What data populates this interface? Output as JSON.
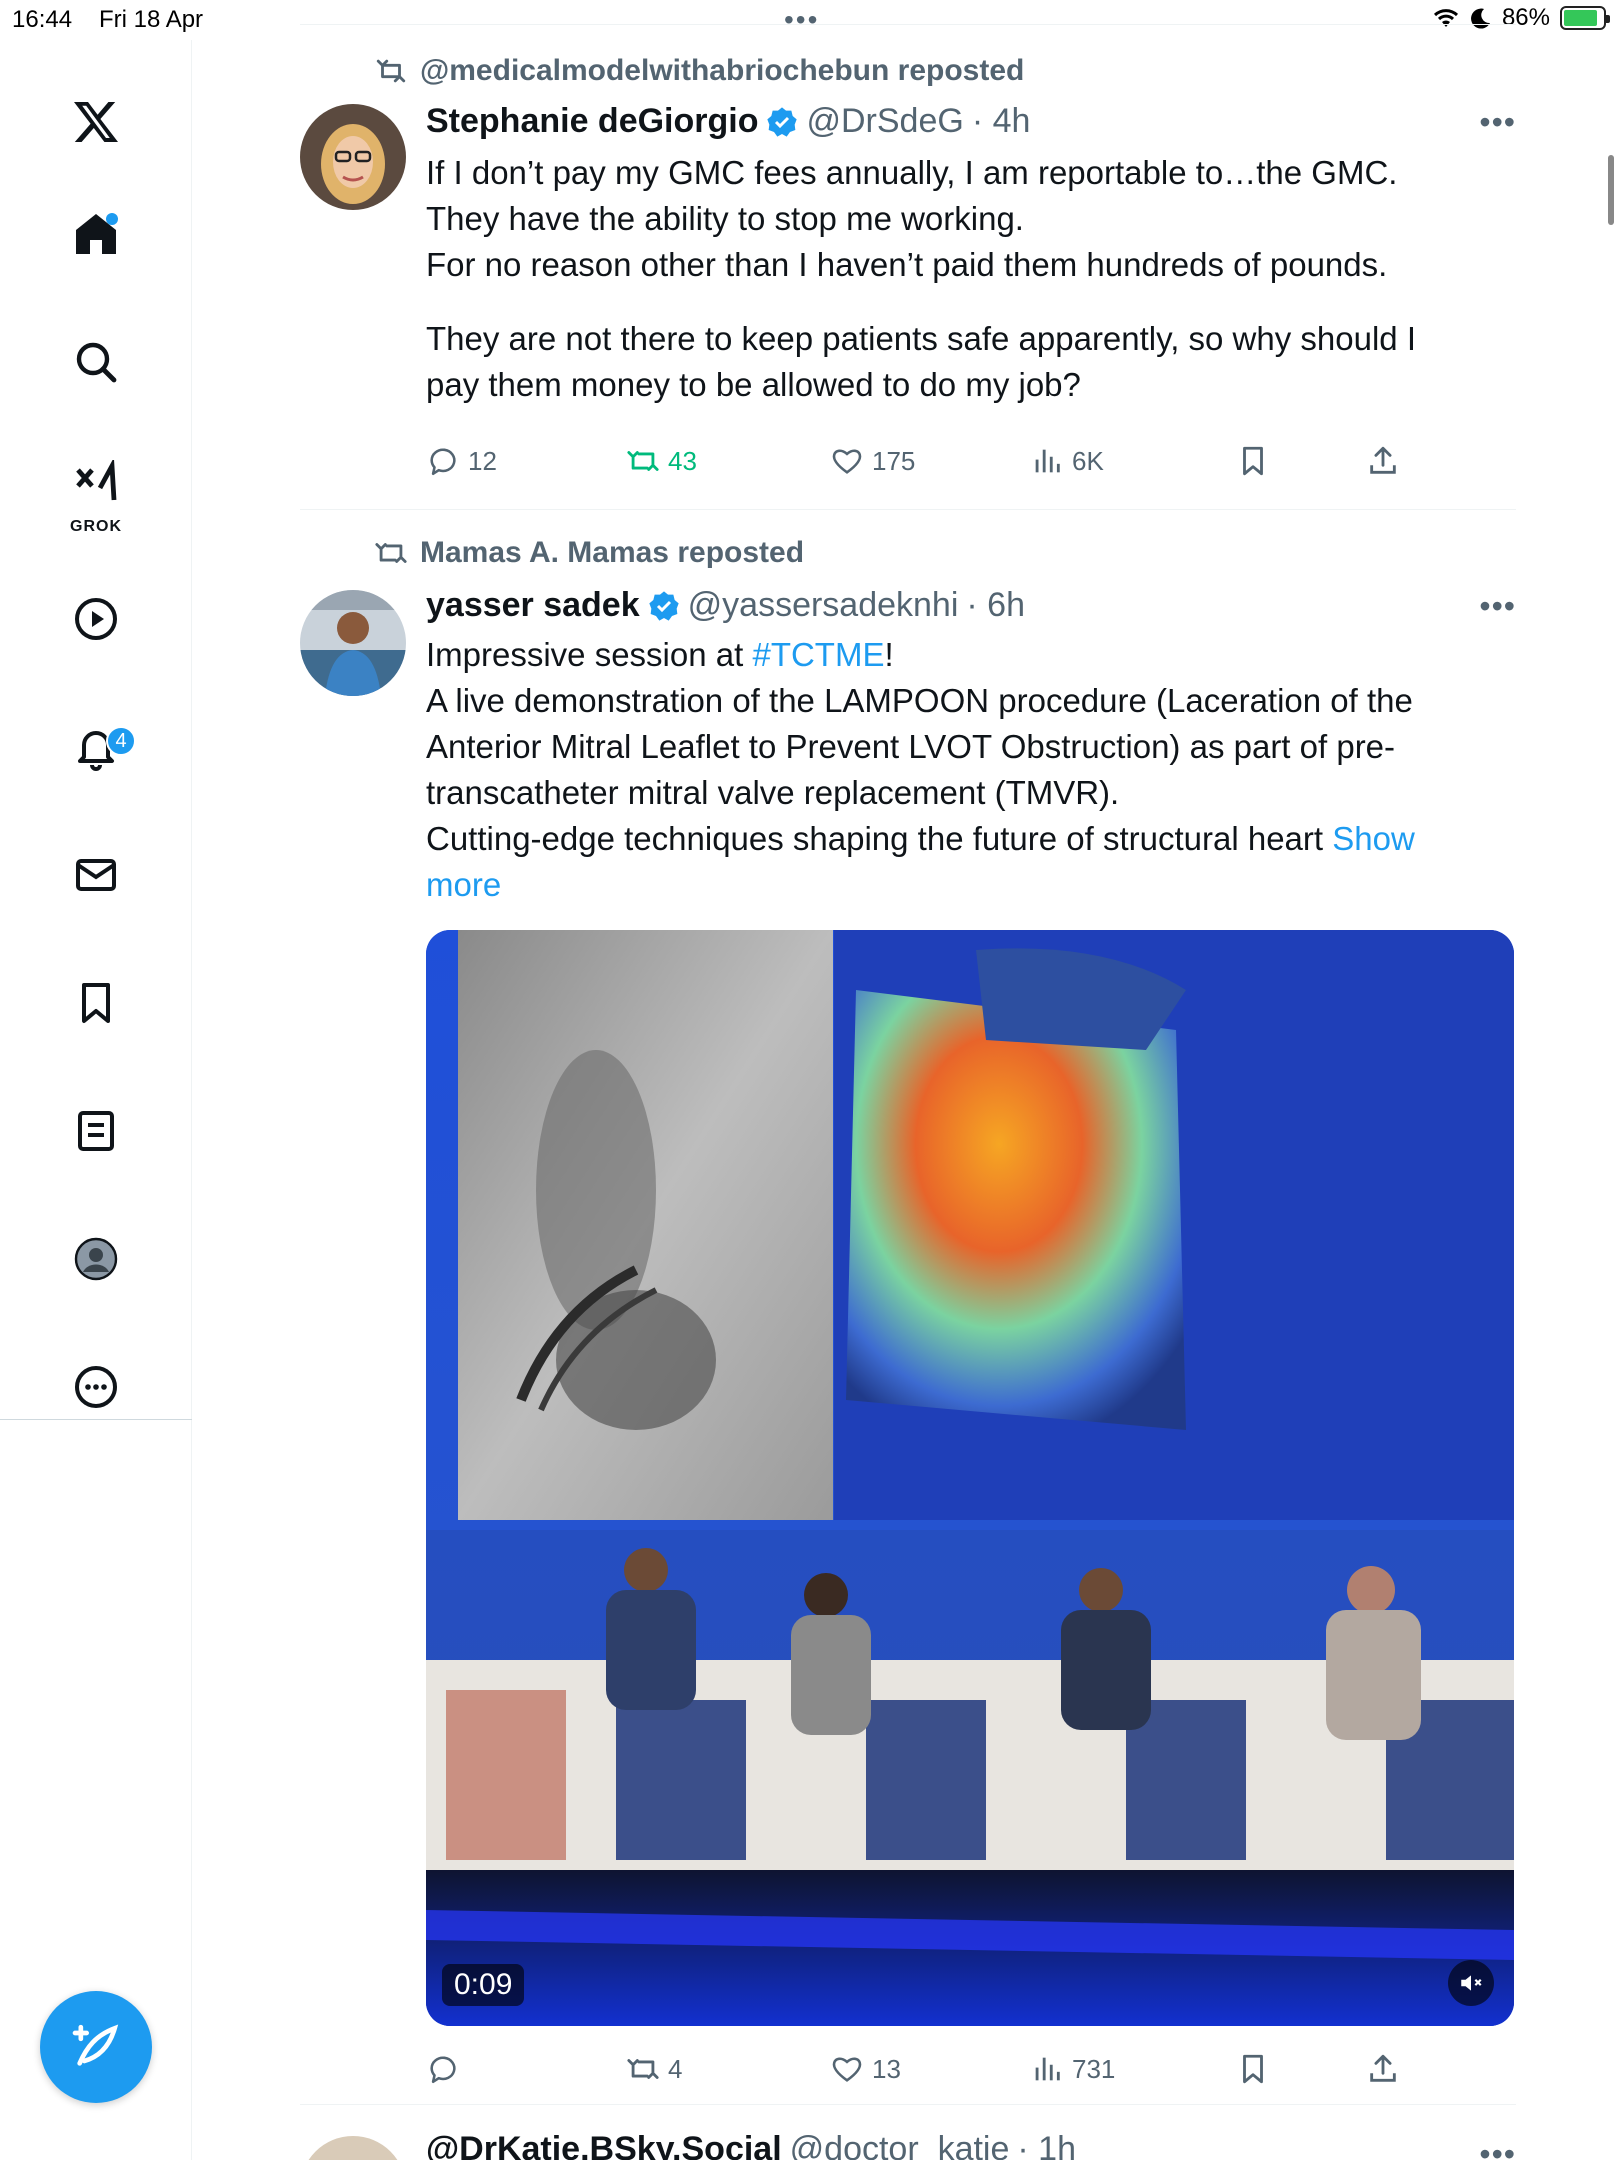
{
  "status_bar": {
    "time": "16:44",
    "date": "Fri 18 Apr",
    "battery": "86%"
  },
  "sidebar": {
    "notifications_badge": "4",
    "grok_label": "GROK"
  },
  "tweets": [
    {
      "reposted_by": "@medicalmodelwithabriochebun reposted",
      "name": "Stephanie deGiorgio",
      "handle": "@DrSdeG",
      "time": "· 4h",
      "lines": [
        "If I don’t pay my GMC fees annually, I am reportable to…the GMC.",
        "They have the ability to stop me working.",
        "For no reason other than I haven’t paid them hundreds of pounds.",
        "",
        "They are not there to keep patients safe apparently, so why should I",
        "pay them money to be allowed to do my job?"
      ],
      "replies": "12",
      "reposts": "43",
      "likes": "175",
      "views": "6K"
    },
    {
      "reposted_by": "Mamas A. Mamas reposted",
      "name": "yasser sadek",
      "handle": "@yassersadeknhi",
      "time": "· 6h",
      "line1_prefix": "Impressive session at ",
      "line1_hashtag": "#TCTME",
      "line1_suffix": "!",
      "lines": [
        "A live demonstration of the LAMPOON procedure (Laceration of the",
        "Anterior Mitral Leaflet to Prevent LVOT Obstruction) as part of pre-",
        "transcatheter mitral valve replacement (TMVR)."
      ],
      "last_line": "Cutting-edge techniques shaping the future of structural heart ",
      "show_more_1": "Show",
      "show_more_2": "more",
      "video_duration": "0:09",
      "replies": "",
      "reposts": "4",
      "likes": "13",
      "views": "731"
    },
    {
      "name": "@DrKatie.BSky.Social",
      "handle": "@doctor_katie",
      "time": "· 1h"
    }
  ]
}
